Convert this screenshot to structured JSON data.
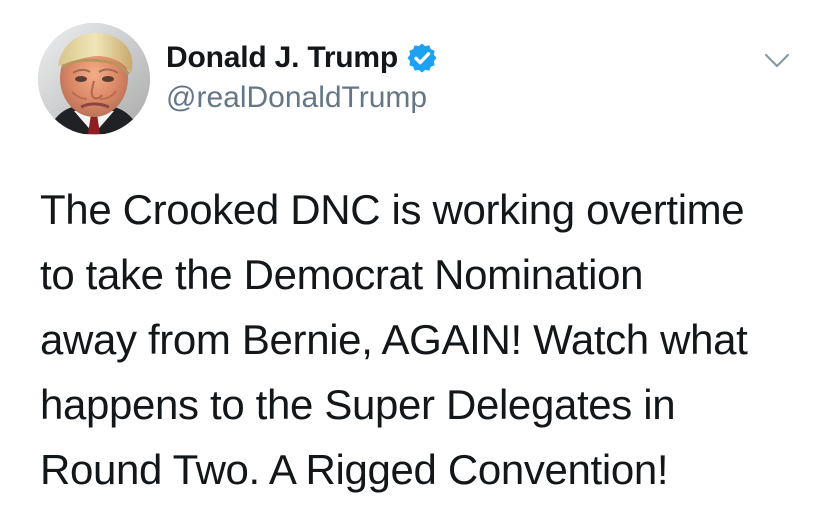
{
  "tweet": {
    "author": {
      "name": "Donald J. Trump",
      "handle": "@realDonaldTrump",
      "verified": true,
      "avatar_description": "profile-photo"
    },
    "text": "The Crooked DNC is working overtime to take the Democrat Nomination away from Bernie, AGAIN! Watch what happens to the Super Delegates in Round Two. A Rigged Convention!",
    "text_lines": [
      "The Crooked DNC is working overtime",
      "to take the Democrat Nomination",
      "away from Bernie, AGAIN! Watch what",
      "happens to the Super Delegates in",
      "Round Two. A Rigged Convention!"
    ]
  },
  "icons": {
    "verified": "verified-badge-icon",
    "menu": "chevron-down-icon"
  },
  "colors": {
    "text": "#14171a",
    "secondary_text": "#657786",
    "verified": "#1da1f2",
    "background": "#ffffff"
  }
}
